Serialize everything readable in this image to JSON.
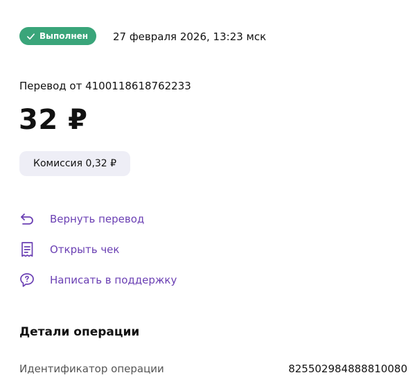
{
  "status": {
    "label": "Выполнен",
    "color": "#3aa57a",
    "icon": "check-icon"
  },
  "date": "27 февраля 2026, 13:23 мск",
  "transfer_from": "Перевод от 4100118618762233",
  "amount": "32 ₽",
  "commission": "Комиссия 0,32 ₽",
  "actions": [
    {
      "label": "Вернуть перевод",
      "icon": "return-arrow-icon"
    },
    {
      "label": "Открыть чек",
      "icon": "receipt-icon"
    },
    {
      "label": "Написать в поддержку",
      "icon": "support-chat-icon"
    }
  ],
  "accent_color": "#6a3fb3",
  "details": {
    "title": "Детали операции",
    "rows": [
      {
        "label": "Идентификатор операции",
        "value": "825502984888810080"
      }
    ]
  }
}
